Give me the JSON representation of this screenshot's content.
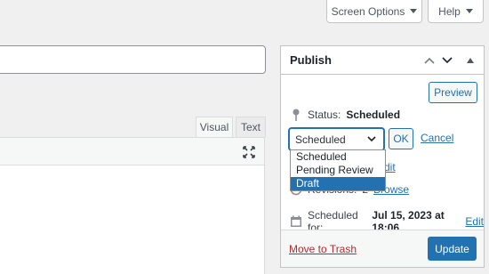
{
  "screen_meta": {
    "screen_options_label": "Screen Options",
    "help_label": "Help"
  },
  "editor": {
    "tab_visual": "Visual",
    "tab_text": "Text"
  },
  "publish": {
    "title": "Publish",
    "preview_label": "Preview",
    "status_label": "Status:",
    "status_value": "Scheduled",
    "status_select_value": "Scheduled",
    "status_options": [
      "Scheduled",
      "Pending Review",
      "Draft"
    ],
    "status_highlighted": "Draft",
    "ok_label": "OK",
    "cancel_label": "Cancel",
    "visibility_edit_label": "dit",
    "revisions_label": "Revisions:",
    "revisions_count": "2",
    "browse_label": "Browse",
    "scheduled_label": "Scheduled for:",
    "scheduled_value": "Jul 15, 2023 at 18:06",
    "scheduled_edit_label": "Edit",
    "trash_label": "Move to Trash",
    "update_label": "Update"
  },
  "colors": {
    "accent": "#2271b1",
    "danger": "#b32d2e",
    "background": "#f0f0f1"
  }
}
